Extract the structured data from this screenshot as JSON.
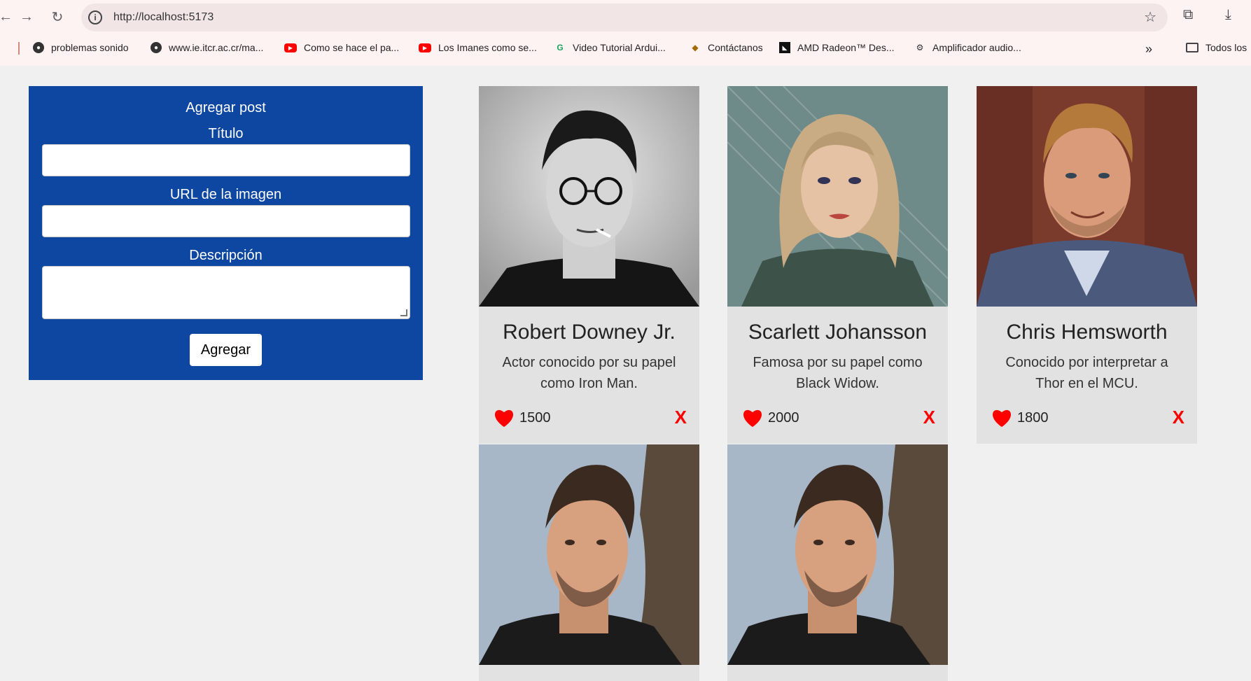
{
  "browser": {
    "url": "http://localhost:5173",
    "bookmarks": [
      {
        "label": "problemas sonido",
        "icon": "globe-icon"
      },
      {
        "label": "www.ie.itcr.ac.cr/ma...",
        "icon": "globe-icon"
      },
      {
        "label": "Como se hace el pa...",
        "icon": "youtube-icon"
      },
      {
        "label": "Los Imanes como se...",
        "icon": "youtube-icon"
      },
      {
        "label": "Video Tutorial Ardui...",
        "icon": "site-icon"
      },
      {
        "label": "Contáctanos",
        "icon": "site-icon"
      },
      {
        "label": "AMD Radeon™ Des...",
        "icon": "amd-icon"
      },
      {
        "label": "Amplificador audio...",
        "icon": "amplifier-icon"
      }
    ],
    "overflow": "»",
    "all_bookmarks": "Todos los"
  },
  "form": {
    "title": "Agregar post",
    "title_label": "Título",
    "url_label": "URL de la imagen",
    "description_label": "Descripción",
    "submit_label": "Agregar"
  },
  "posts": [
    {
      "title": "Robert Downey Jr.",
      "description": "Actor conocido por su papel como Iron Man.",
      "likes": "1500"
    },
    {
      "title": "Scarlett Johansson",
      "description": "Famosa por su papel como Black Widow.",
      "likes": "2000"
    },
    {
      "title": "Chris Hemsworth",
      "description": "Conocido por interpretar a Thor en el MCU.",
      "likes": "1800"
    },
    {
      "title": "",
      "description": "",
      "likes": ""
    },
    {
      "title": "",
      "description": "",
      "likes": ""
    }
  ],
  "colors": {
    "form_bg": "#0d47a1",
    "card_bg": "#e2e2e2",
    "accent_red": "#ff0000",
    "page_bg": "#f0f0f0"
  },
  "delete_glyph": "X"
}
